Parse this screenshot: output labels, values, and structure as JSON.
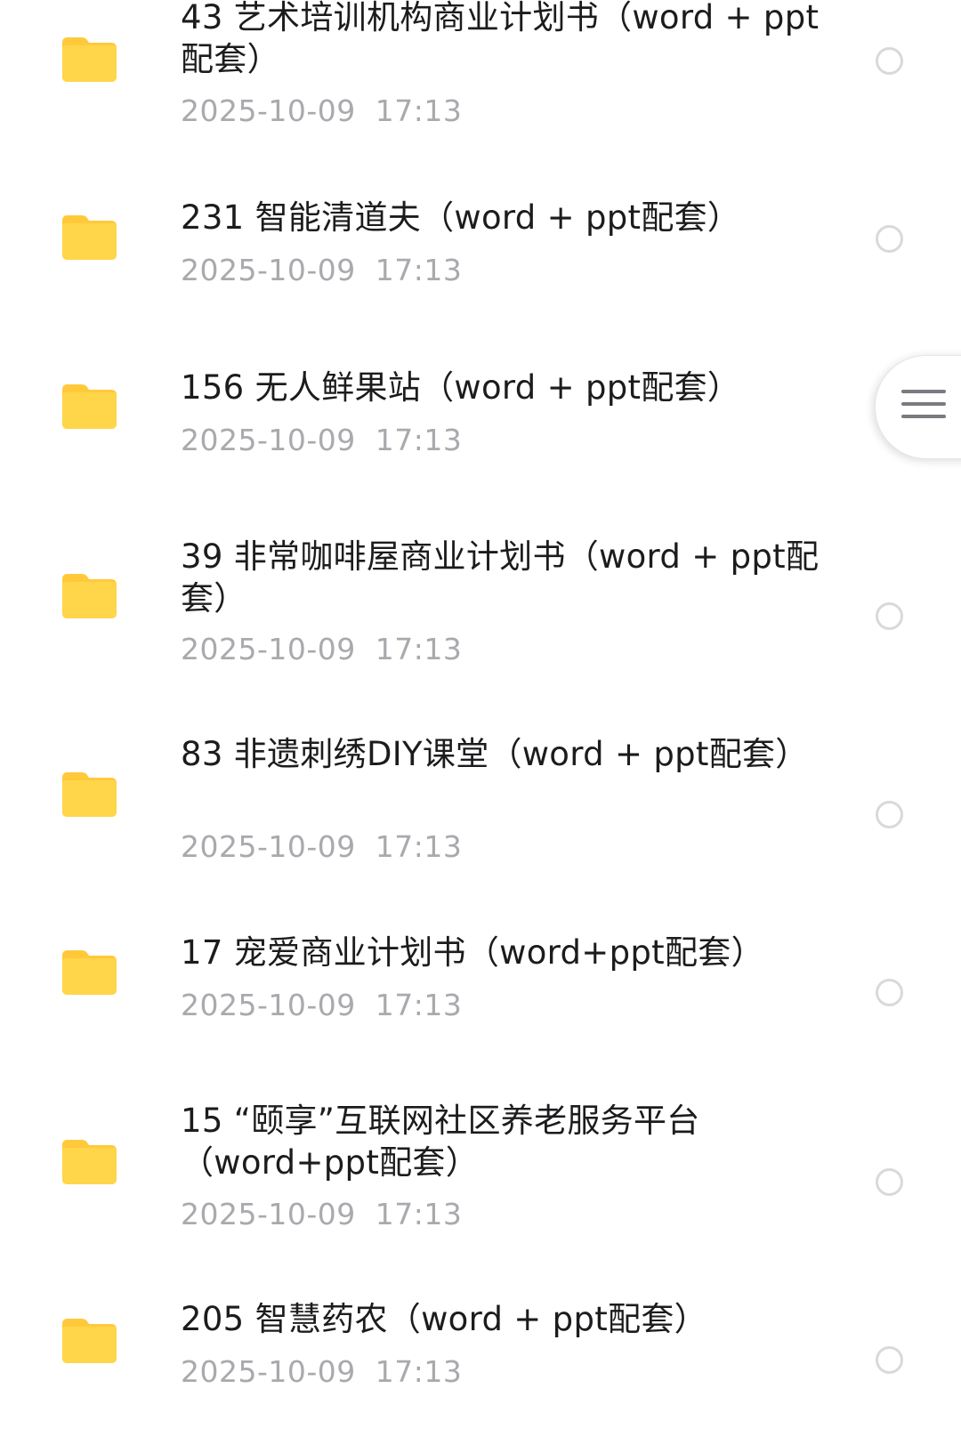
{
  "colors": {
    "folder": "#FFD54A",
    "folder_tab": "#FFC93A",
    "title": "#1C1C1E",
    "date": "#A9A9AE",
    "radio_border": "#D9D9DC"
  },
  "files": [
    {
      "title": "43 艺术培训机构商业计划书（word + ppt配套）",
      "date": "2025-10-09  17:13",
      "icon": "folder-icon"
    },
    {
      "title": "231  智能清道夫（word + ppt配套）",
      "date": "2025-10-09  17:13",
      "icon": "folder-icon"
    },
    {
      "title": "156  无人鲜果站（word + ppt配套）",
      "date": "2025-10-09  17:13",
      "icon": "folder-icon"
    },
    {
      "title": "39 非常咖啡屋商业计划书（word + ppt配套）",
      "date": "2025-10-09  17:13",
      "icon": "folder-icon"
    },
    {
      "title": "83  非遗刺绣DIY课堂（word + ppt配套）",
      "date": "2025-10-09  17:13",
      "icon": "folder-icon"
    },
    {
      "title": "17  宠爱商业计划书（word+ppt配套）",
      "date": "2025-10-09  17:13",
      "icon": "folder-icon"
    },
    {
      "title": "15 “颐享”互联网社区养老服务平台（word+ppt配套）",
      "date": "2025-10-09  17:13",
      "icon": "folder-icon"
    },
    {
      "title": "205  智慧药农（word + ppt配套）",
      "date": "2025-10-09  17:13",
      "icon": "folder-icon"
    }
  ],
  "floating_menu": {
    "icon": "menu-icon"
  }
}
